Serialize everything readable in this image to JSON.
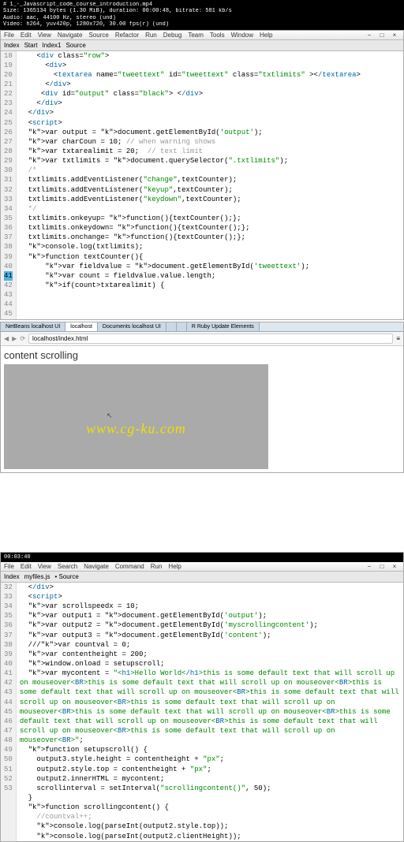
{
  "video": {
    "line1": "# 1_-_Javascript_code_course_introduction.mp4",
    "line2": "Size: 1365134 bytes (1.30 MiB), duration: 00:00:48, bitrate: 581 kb/s",
    "line3": "Audio: aac, 44100 Hz, stereo (und)",
    "line4": "Video: h264, yuv420p, 1280x720, 30.00 fps(r) (und)"
  },
  "menu1": [
    "File",
    "Edit",
    "View",
    "Navigate",
    "Source",
    "Refactor",
    "Run",
    "Debug",
    "Team",
    "Tools",
    "Window",
    "Help"
  ],
  "menu2": [
    "File",
    "Edit",
    "View",
    "Search",
    "Navigate",
    "Command",
    "Run",
    "Help"
  ],
  "tabs1": [
    "Index",
    "Start",
    "Index1",
    "Source"
  ],
  "tabs2": [
    "Index",
    "myfiles.js",
    "• Source"
  ],
  "wm": "www.cg-ku.com",
  "browser": {
    "tabs": [
      "NetBeans localhost UI",
      "localhost",
      "Documents localhost UI",
      "",
      "",
      "R Ruby Update Elements"
    ],
    "url": "localhost/index.html",
    "title": "content scrolling"
  },
  "code1_lines": [
    18,
    19,
    20,
    21,
    22,
    23,
    24,
    25,
    26,
    27,
    28,
    29,
    30,
    31,
    32,
    33,
    34,
    35,
    36,
    37,
    38,
    39,
    40,
    41,
    42,
    43,
    44,
    45
  ],
  "code1_hl": 41,
  "code1": [
    "    <div class=\"row\">",
    "      <div>",
    "        <textarea name=\"tweettext\" id=\"tweettext\" class=\"txtlimits\" ></textarea>",
    "      </div>",
    "     <div id=\"output\" class=\"black\"> </div>",
    "    </div>",
    "  </div>",
    "  <script>",
    "  var output = document.getElementById('output');",
    "  var charCoun = 10; // when warning shows",
    "  var txtarealimit = 20;  // text limit",
    "",
    "  var txtlimits = document.querySelector(\".txtlimits\");",
    "  /*",
    "  txtlimits.addEventListener(\"change\",textCounter);",
    "  txtlimits.addEventListener(\"keyup\",textCounter);",
    "  txtlimits.addEventListener(\"keydown\",textCounter);",
    "  */",
    "  txtlimits.onkeyup= function(){textCounter();};",
    "  txtlimits.onkeydown= function(){textCounter();};",
    "  txtlimits.onchange= function(){textCounter();};",
    "",
    "  console.log(txtlimits);",
    "",
    "  function textCounter(){",
    "      var fieldvalue = document.getElementById('tweettext');",
    "      var count = fieldvalue.value.length;",
    "      if(count>txtarealimit) {"
  ],
  "code2_lines": [
    32,
    33,
    34,
    35,
    36,
    37,
    38,
    39,
    40,
    41,
    42,
    43,
    44,
    45,
    46,
    47,
    48,
    49,
    50,
    51,
    52,
    53
  ],
  "code2": [
    "  </div>",
    "  <script>",
    "  var scrollspeedx = 10;",
    "  var output1 = document.getElementById('output');",
    "  var output2 = document.getElementById('myscrollingcontent');",
    "  var output3 = document.getElementById('content');",
    "  ///var countval = 0;",
    "  var contentheight = 200;",
    "  window.onload = setupscroll;",
    "  var mycontent = \"<h1>Hello World</h1>this is some default text that will scroll up on mouseover<BR>this is some default text that will scroll up on mouseover<BR>this is some default text that will scroll up on mouseover<BR>this is some default text that will scroll up on mouseover<BR>this is some default text that will scroll up on mouseover<BR>this is some default text that will scroll up on mouseover<BR>this is some default text that will scroll up on mouseover<BR>this is some default text that will scroll up on mouseover<BR>this is some default text that will scroll up on mouseover<BR>\";",
    "",
    "  function setupscroll() {",
    "    output3.style.height = contentheight + \"px\";",
    "    output2.style.top = contentheight + \"px\";",
    "    output2.innerHTML = mycontent;",
    "    scrollinterval = setInterval(\"scrollingcontent()\", 50);",
    "  }",
    "",
    "  function scrollingcontent() {",
    "    //countval++;",
    "    console.log(parseInt(output2.style.top));",
    "    console.log(parseInt(output2.clientHeight));"
  ]
}
